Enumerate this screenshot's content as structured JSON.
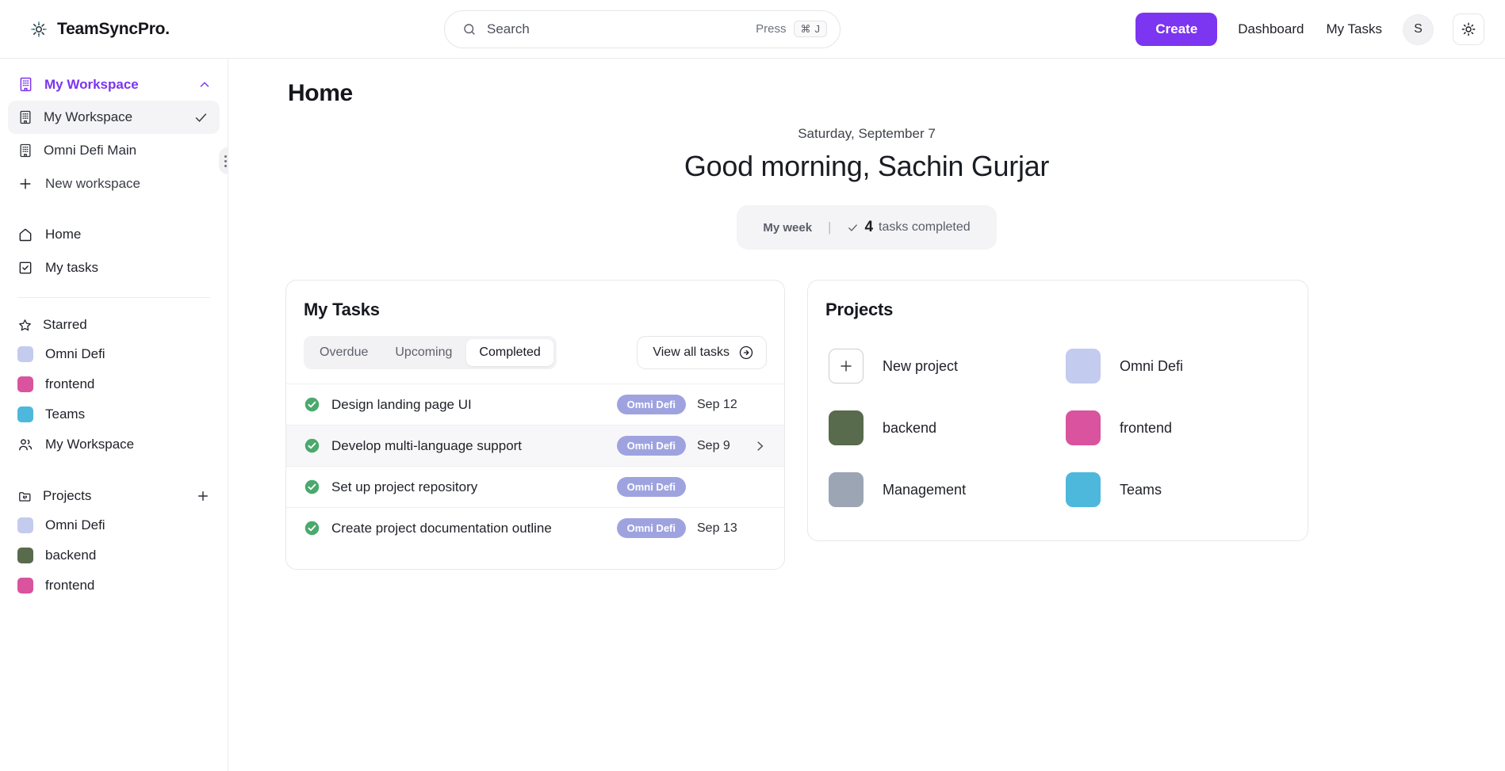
{
  "brand": {
    "name": "TeamSyncPro.",
    "icon": "gear-sparkle-icon"
  },
  "search": {
    "placeholder": "Search",
    "value": "",
    "press_label": "Press",
    "kbd_cmd": "⌘",
    "kbd_key": "J"
  },
  "topbar": {
    "create_label": "Create",
    "dashboard_label": "Dashboard",
    "mytasks_label": "My Tasks",
    "avatar_initial": "S",
    "theme_icon": "sun-icon",
    "accent_color": "#7c35f0"
  },
  "sidebar": {
    "workspace_header": {
      "label": "My Workspace",
      "icon": "building-icon",
      "chevron": "chevron-up-icon"
    },
    "workspaces": [
      {
        "label": "My Workspace",
        "icon": "building-icon",
        "selected": true
      },
      {
        "label": "Omni Defi Main",
        "icon": "building-icon",
        "selected": false
      }
    ],
    "new_workspace_label": "New workspace",
    "nav": [
      {
        "label": "Home",
        "icon": "home-icon"
      },
      {
        "label": "My tasks",
        "icon": "checkbox-icon"
      }
    ],
    "starred": {
      "title": "Starred",
      "icon": "star-icon",
      "items": [
        {
          "label": "Omni Defi",
          "color": "#c3cbee"
        },
        {
          "label": "frontend",
          "color": "#d9539f"
        },
        {
          "label": "Teams",
          "color": "#4db8dc"
        },
        {
          "label": "My Workspace",
          "icon": "people-icon"
        }
      ]
    },
    "projects": {
      "title": "Projects",
      "icon": "folder-kanban-icon",
      "add_icon": "plus-icon",
      "items": [
        {
          "label": "Omni Defi",
          "color": "#c3cbee"
        },
        {
          "label": "backend",
          "color": "#586b4c"
        },
        {
          "label": "frontend",
          "color": "#d9539f"
        }
      ]
    }
  },
  "main": {
    "page_title": "Home",
    "date": "Saturday, September 7",
    "greeting": "Good morning, Sachin Gurjar",
    "stat": {
      "my_week": "My week",
      "separator": "|",
      "count": "4",
      "label": "tasks completed",
      "check_icon": "check-icon"
    }
  },
  "my_tasks_card": {
    "title": "My Tasks",
    "tabs": [
      {
        "label": "Overdue",
        "active": false
      },
      {
        "label": "Upcoming",
        "active": false
      },
      {
        "label": "Completed",
        "active": true
      }
    ],
    "view_all_label": "View all tasks",
    "view_all_icon": "arrow-right-circle-icon",
    "rows": [
      {
        "name": "Design landing page UI",
        "badge": "Omni Defi",
        "date": "Sep 12",
        "completed": true,
        "hovered": false
      },
      {
        "name": "Develop multi-language support",
        "badge": "Omni Defi",
        "date": "Sep 9",
        "completed": true,
        "hovered": true
      },
      {
        "name": "Set up project repository",
        "badge": "Omni Defi",
        "date": "",
        "completed": true,
        "hovered": false
      },
      {
        "name": "Create project documentation outline",
        "badge": "Omni Defi",
        "date": "Sep 13",
        "completed": true,
        "hovered": false
      }
    ],
    "badge_color": "#9ea3e0",
    "check_color": "#4aa96c"
  },
  "projects_card": {
    "title": "Projects",
    "items": [
      {
        "label": "New project",
        "color": "",
        "is_new": true
      },
      {
        "label": "Omni Defi",
        "color": "#c3cbee",
        "is_new": false
      },
      {
        "label": "backend",
        "color": "#586b4c",
        "is_new": false
      },
      {
        "label": "frontend",
        "color": "#d9539f",
        "is_new": false
      },
      {
        "label": "Management",
        "color": "#9ba5b4",
        "is_new": false
      },
      {
        "label": "Teams",
        "color": "#4db8dc",
        "is_new": false
      }
    ]
  }
}
